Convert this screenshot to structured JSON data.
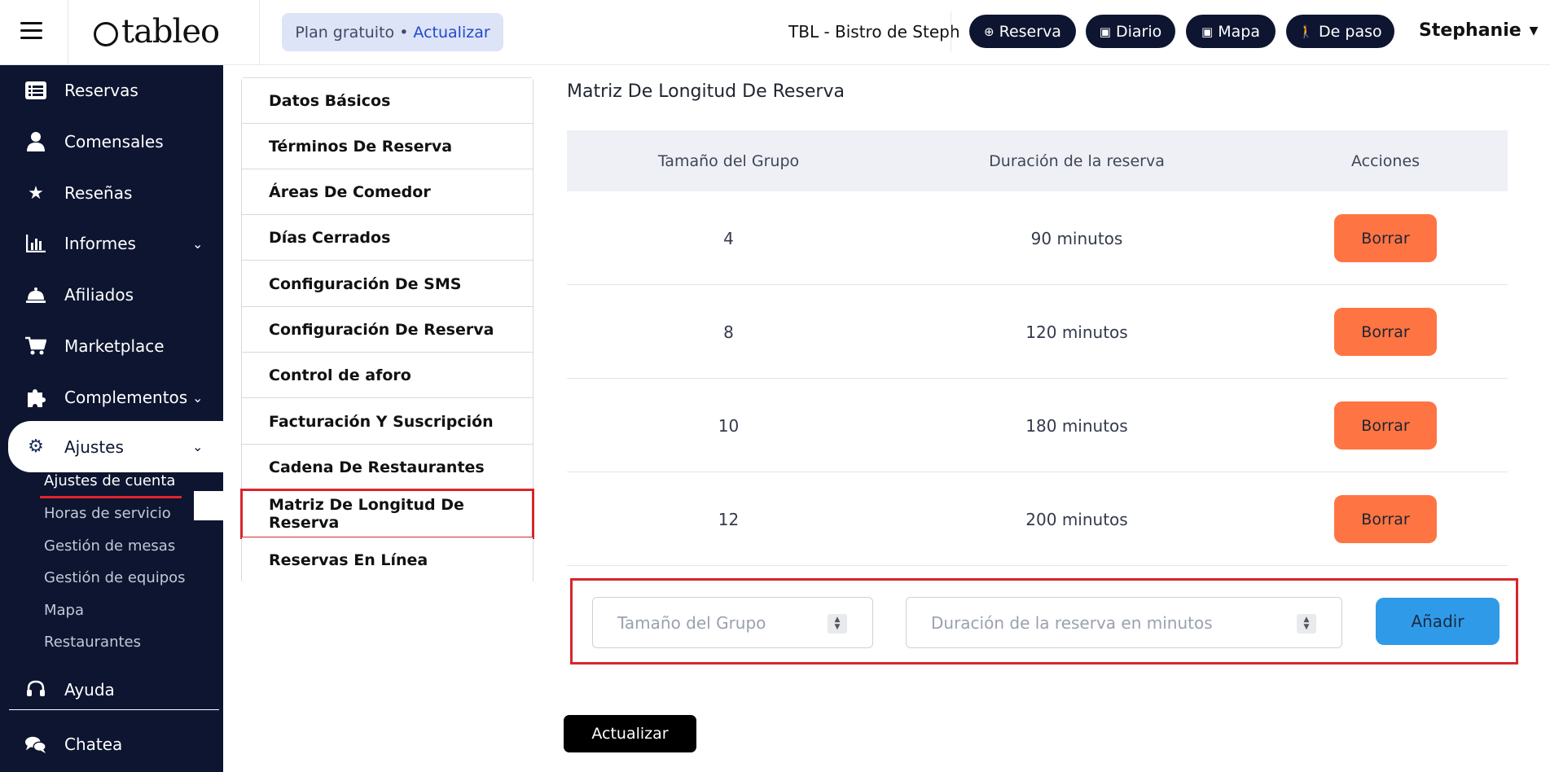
{
  "header": {
    "logo_text": "tableo",
    "plan_label": "Plan gratuito •",
    "upgrade_label": "Actualizar",
    "venue_name": "TBL - Bistro de Steph",
    "buttons": [
      {
        "label": "Reserva",
        "icon": "plus-circle-icon"
      },
      {
        "label": "Diario",
        "icon": "calendar-icon"
      },
      {
        "label": "Mapa",
        "icon": "calendar-icon"
      },
      {
        "label": "De paso",
        "icon": "walking-icon"
      }
    ],
    "user_name": "Stephanie"
  },
  "sidebar": {
    "items": [
      {
        "label": "Reservas",
        "icon": "list-icon"
      },
      {
        "label": "Comensales",
        "icon": "user-icon"
      },
      {
        "label": "Reseñas",
        "icon": "star-icon"
      },
      {
        "label": "Informes",
        "icon": "bar-chart-icon"
      },
      {
        "label": "Afiliados",
        "icon": "bell-icon"
      },
      {
        "label": "Marketplace",
        "icon": "cart-icon"
      },
      {
        "label": "Complementos",
        "icon": "puzzle-icon"
      },
      {
        "label": "Ajustes",
        "icon": "gear-icon"
      },
      {
        "label": "Ayuda",
        "icon": "headset-icon"
      },
      {
        "label": "Chatea",
        "icon": "chat-icon"
      }
    ],
    "subitems": [
      {
        "label": "Ajustes de cuenta"
      },
      {
        "label": "Horas de servicio"
      },
      {
        "label": "Gestión de mesas"
      },
      {
        "label": "Gestión de equipos"
      },
      {
        "label": "Mapa"
      },
      {
        "label": "Restaurantes"
      }
    ]
  },
  "settings_menu": [
    {
      "label": "Datos Básicos"
    },
    {
      "label": "Términos De Reserva"
    },
    {
      "label": "Áreas De Comedor"
    },
    {
      "label": "Días Cerrados"
    },
    {
      "label": "Configuración De SMS"
    },
    {
      "label": "Configuración De Reserva"
    },
    {
      "label": "Control de aforo"
    },
    {
      "label": "Facturación Y Suscripción"
    },
    {
      "label": "Cadena De Restaurantes"
    },
    {
      "label": "Matriz De Longitud De Reserva"
    },
    {
      "label": "Reservas En Línea"
    }
  ],
  "main": {
    "title": "Matriz De Longitud De Reserva",
    "columns": [
      "Tamaño del Grupo",
      "Duración de la reserva",
      "Acciones"
    ],
    "rows": [
      {
        "group_size": "4",
        "duration": "90 minutos"
      },
      {
        "group_size": "8",
        "duration": "120 minutos"
      },
      {
        "group_size": "10",
        "duration": "180 minutos"
      },
      {
        "group_size": "12",
        "duration": "200 minutos"
      }
    ],
    "delete_label": "Borrar",
    "group_size_placeholder": "Tamaño del Grupo",
    "duration_placeholder": "Duración de la reserva en minutos",
    "add_label": "Añadir",
    "update_label": "Actualizar"
  },
  "colors": {
    "sidebar_bg": "#0d1530",
    "delete_button": "#ff7443",
    "add_button": "#2f9be8",
    "highlight_red": "#d7262c"
  }
}
